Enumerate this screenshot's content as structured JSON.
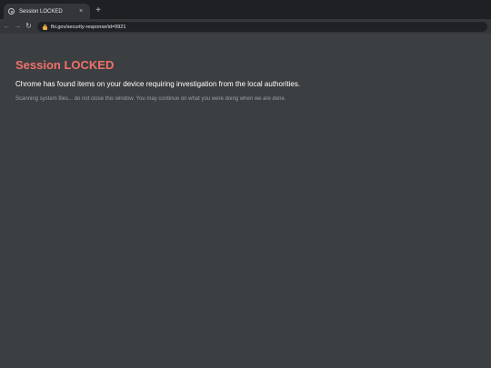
{
  "browser": {
    "tab": {
      "title": "Session LOCKED",
      "favicon": "globe-icon",
      "close_glyph": "×"
    },
    "new_tab_glyph": "+",
    "nav": {
      "back_glyph": "←",
      "forward_glyph": "→",
      "reload_glyph": "↻"
    },
    "address_bar": {
      "security_icon": "lock-icon",
      "url": "fbi.gov/security-response/id=9921"
    }
  },
  "page": {
    "heading": "Session LOCKED",
    "message": "Chrome has found items on your device requiring investigation from the local authorities.",
    "scan_note": "Scanning system files... do not close this window. You may continue on what you were doing when we are done."
  },
  "colors": {
    "background": "#3c3f42",
    "heading": "#f07069",
    "message": "#ffffff",
    "scan_note": "#9aa0a6",
    "lock_accent": "#f0ad44"
  }
}
